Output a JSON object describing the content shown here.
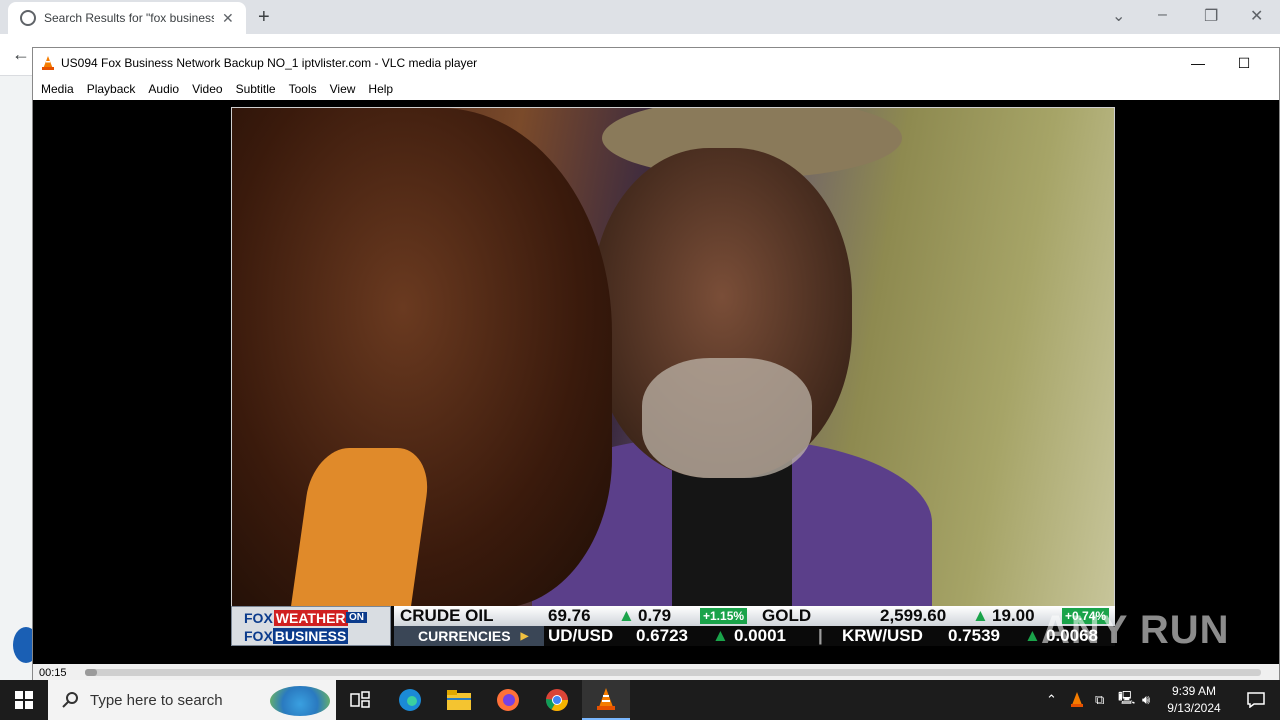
{
  "browser": {
    "tab_title": "Search Results for \"fox business\"",
    "tab_close": "✕",
    "new_tab": "+"
  },
  "vlc": {
    "title": "US094 Fox Business Network Backup NO_1 iptvlister.com - VLC media player",
    "menu": [
      "Media",
      "Playback",
      "Audio",
      "Video",
      "Subtitle",
      "Tools",
      "View",
      "Help"
    ],
    "elapsed": "00:15",
    "progress": 0.01
  },
  "ticker": {
    "logo_line1": "FOX",
    "logo_weather": "WEATHER",
    "logo_on": "ON",
    "logo_line2": "FOX",
    "logo_business": "BUSINESS",
    "crude_label": "CRUDE OIL",
    "crude_price": "69.76",
    "crude_change": "0.79",
    "crude_pct": "+1.15%",
    "gold_label": "GOLD",
    "gold_price": "2,599.60",
    "gold_change": "19.00",
    "gold_pct": "+0.74%",
    "currencies_label": "CURRENCIES",
    "pair1": "UD/USD",
    "pair1_value": "0.6723",
    "pair1_change": "0.0001",
    "pair2": "KRW/USD",
    "pair2_value": "0.7539",
    "pair2_change": "0.0068"
  },
  "watermark": "ANY RUN",
  "taskbar": {
    "search_placeholder": "Type here to search",
    "time": "9:39 AM",
    "date": "9/13/2024"
  },
  "colors": {
    "vlc_orange": "#f57c00",
    "ticker_green": "#1aa34a",
    "fox_blue": "#0b3b8c"
  }
}
